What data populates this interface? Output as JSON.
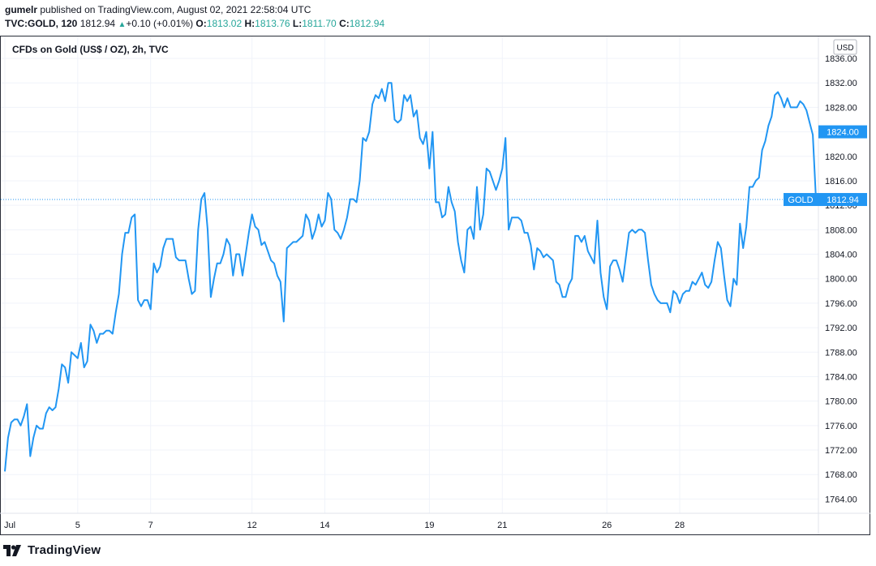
{
  "header": {
    "author": "gumelr",
    "published_text": "published on TradingView.com, August 02, 2021 22:58:04 UTC",
    "symbol": "TVC:GOLD, 120",
    "last": "1812.94",
    "change_arrow": "▲",
    "change": "+0.10 (+0.01%)",
    "o_label": "O:",
    "o_value": "1813.02",
    "h_label": "H:",
    "h_value": "1813.76",
    "l_label": "L:",
    "l_value": "1811.70",
    "c_label": "C:",
    "c_value": "1812.94"
  },
  "footer": {
    "brand": "TradingView",
    "logo_icon": "tradingview-logo-icon"
  },
  "chart_data": {
    "type": "line",
    "title": "CFDs on Gold (US$ / OZ), 2h, TVC",
    "currency_label": "USD",
    "ylim": [
      1761,
      1837
    ],
    "y_ticks": [
      1764,
      1768,
      1772,
      1776,
      1780,
      1784,
      1788,
      1792,
      1796,
      1800,
      1804,
      1808,
      1812,
      1816,
      1820,
      1824,
      1828,
      1832,
      1836
    ],
    "y_tick_labels": [
      "1764.00",
      "1768.00",
      "1772.00",
      "1776.00",
      "1780.00",
      "1784.00",
      "1788.00",
      "1792.00",
      "1796.00",
      "1800.00",
      "1804.00",
      "1808.00",
      "1812.00",
      "1816.00",
      "1820.00",
      "1824.00",
      "1828.00",
      "1832.00",
      "1836.00"
    ],
    "x_ticks": [
      {
        "label": "Jul",
        "i": 0
      },
      {
        "label": "5",
        "i": 23
      },
      {
        "label": "7",
        "i": 46
      },
      {
        "label": "12",
        "i": 78
      },
      {
        "label": "14",
        "i": 101
      },
      {
        "label": "19",
        "i": 134
      },
      {
        "label": "21",
        "i": 157
      },
      {
        "label": "26",
        "i": 190
      },
      {
        "label": "28",
        "i": 213
      }
    ],
    "series": [
      {
        "color": "#2196f3",
        "values": [
          1768.5,
          1774,
          1776.5,
          1777,
          1777,
          1776,
          1777.5,
          1779.5,
          1771,
          1774,
          1776,
          1775.5,
          1775.5,
          1778,
          1779,
          1778.5,
          1779,
          1782,
          1786,
          1785.5,
          1783,
          1788,
          1787.5,
          1787,
          1789.5,
          1785.5,
          1786.5,
          1792.5,
          1791.5,
          1789.5,
          1791,
          1791,
          1791.5,
          1791.5,
          1791,
          1794.5,
          1797.5,
          1804,
          1807.5,
          1807.5,
          1810,
          1810.5,
          1796.5,
          1795.5,
          1796.5,
          1796.5,
          1795,
          1802.5,
          1801,
          1802,
          1805,
          1806.5,
          1806.5,
          1806.5,
          1803.5,
          1803,
          1803,
          1803,
          1800,
          1797.5,
          1798,
          1808,
          1813,
          1814,
          1808,
          1797,
          1800,
          1802.5,
          1802.5,
          1804,
          1806.5,
          1805.5,
          1800.5,
          1804,
          1804,
          1800.5,
          1804,
          1807.5,
          1810.5,
          1808.5,
          1808,
          1805.5,
          1806,
          1804.5,
          1803,
          1802.5,
          1800.5,
          1799.5,
          1793,
          1805,
          1805.5,
          1806,
          1806,
          1806.5,
          1807,
          1810.5,
          1809.5,
          1806.5,
          1808,
          1810.5,
          1808.5,
          1809.5,
          1814,
          1813,
          1808,
          1807.5,
          1806.5,
          1808,
          1810,
          1813,
          1813,
          1812.5,
          1816,
          1823,
          1822.5,
          1824,
          1828.5,
          1830,
          1829.5,
          1831,
          1829,
          1832,
          1832,
          1826,
          1825.5,
          1826,
          1830,
          1829,
          1830,
          1826.5,
          1827.5,
          1823,
          1822,
          1824,
          1818,
          1824,
          1812.5,
          1812.5,
          1810,
          1810.5,
          1815,
          1812.5,
          1811,
          1806,
          1803,
          1801,
          1808,
          1808.5,
          1806.5,
          1815,
          1808,
          1810.5,
          1818,
          1817.5,
          1816,
          1814.5,
          1816,
          1818,
          1823,
          1808,
          1810,
          1810,
          1810,
          1809.5,
          1807.5,
          1807.5,
          1805.5,
          1801.5,
          1805,
          1804.5,
          1803.5,
          1804,
          1803.5,
          1803,
          1799.5,
          1799,
          1797,
          1797,
          1799,
          1800,
          1807,
          1807,
          1806,
          1807,
          1804.5,
          1803.5,
          1802.5,
          1809.5,
          1801,
          1797,
          1795,
          1802,
          1803,
          1803,
          1801.5,
          1799.5,
          1803.5,
          1807.5,
          1808,
          1807.5,
          1808,
          1808,
          1807.5,
          1803,
          1799,
          1797.5,
          1796.5,
          1796,
          1796,
          1796,
          1794.5,
          1798,
          1797.5,
          1796,
          1797.5,
          1798,
          1798,
          1799.5,
          1799,
          1800,
          1801,
          1799,
          1798.5,
          1799.5,
          1803,
          1806,
          1805,
          1800.5,
          1796.5,
          1795.5,
          1800,
          1799,
          1809,
          1805,
          1808.5,
          1815,
          1815,
          1816,
          1816.5,
          1821,
          1822.5,
          1825,
          1826.5,
          1830,
          1830.5,
          1829.5,
          1828,
          1829.5,
          1828,
          1828,
          1828,
          1829,
          1828.5,
          1827.5,
          1825.5,
          1823.5,
          1812.94
        ]
      }
    ],
    "last_value_label": "1812.94",
    "last_value_name": "GOLD",
    "crosshair_label": "1824.00",
    "line_color": "#2196f3",
    "grid": true
  }
}
